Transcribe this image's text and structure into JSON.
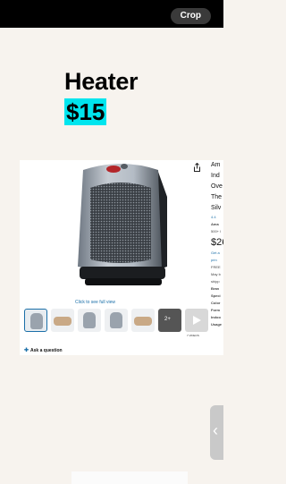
{
  "toolbar": {
    "crop_label": "Crop"
  },
  "note": {
    "title": "Heater",
    "price": "$15"
  },
  "product": {
    "see_full_view": "Click to see full view",
    "ask_question": "Ask a question",
    "more_count": "2+",
    "video_count": "7 VIDEOS",
    "title_fragment": [
      "Am",
      "Ind",
      "Ove",
      "The",
      "Silv"
    ],
    "rating": "4.4",
    "badge": "Ama",
    "bought": "500+ l",
    "price": "$26",
    "get_label": "Get a",
    "prime": "prin",
    "free": "FREE",
    "may": "May b",
    "ship": "shipp",
    "brand": "Bran",
    "spec": "Speci",
    "color": "Color",
    "form": "Form",
    "indoor": "Indoo",
    "usage": "Usage"
  },
  "colors": {
    "highlight": "#00e5ee",
    "link": "#1a6fa8"
  }
}
